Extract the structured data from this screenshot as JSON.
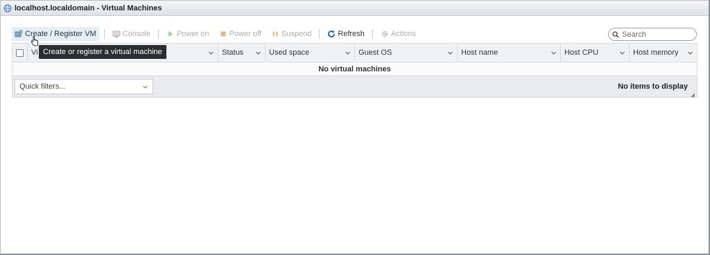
{
  "window": {
    "title": "localhost.localdomain - Virtual Machines",
    "icon": "vm-globe-icon"
  },
  "toolbar": {
    "create_label": "Create / Register VM",
    "console_label": "Console",
    "power_on_label": "Power on",
    "power_off_label": "Power off",
    "suspend_label": "Suspend",
    "refresh_label": "Refresh",
    "actions_label": "Actions"
  },
  "search": {
    "placeholder": "Search"
  },
  "grid": {
    "columns": [
      {
        "label": "Vi"
      },
      {
        "label": "Status"
      },
      {
        "label": "Used space"
      },
      {
        "label": "Guest OS"
      },
      {
        "label": "Host name"
      },
      {
        "label": "Host CPU"
      },
      {
        "label": "Host memory"
      }
    ],
    "empty_message": "No virtual machines",
    "quick_filters_label": "Quick filters...",
    "items_count_label": "No items to display"
  },
  "tooltip": {
    "text": "Create or register a virtual machine"
  },
  "colors": {
    "refresh_blue": "#1e6fc1",
    "power_on_green": "#7cc47b",
    "power_off_orange": "#e0a060",
    "suspend_orange": "#e8b26a",
    "create_green": "#3a9a3a"
  }
}
